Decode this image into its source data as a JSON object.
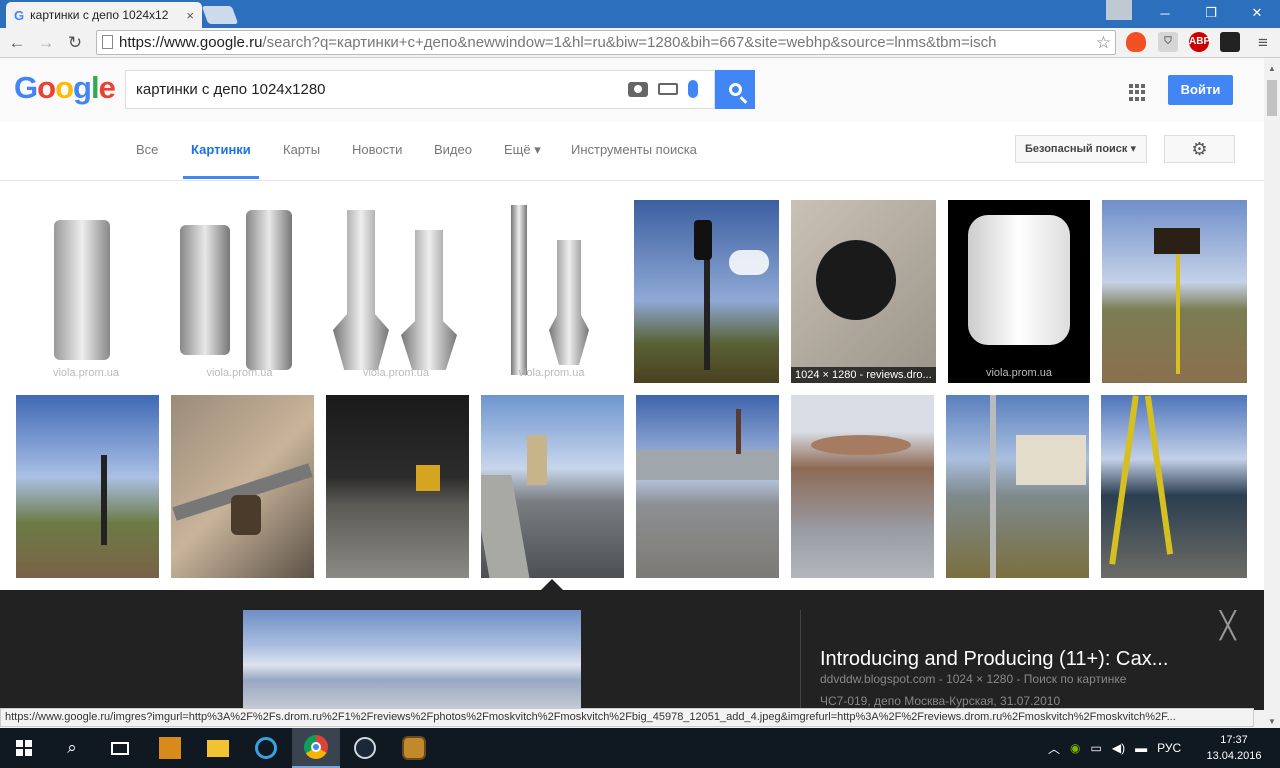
{
  "browser": {
    "tab_title": "картинки с депо 1024x12",
    "tab_close": "×",
    "url_host": "https://www.google.ru",
    "url_rest": "/search?q=картинки+с+депо&newwindow=1&hl=ru&biw=1280&bih=667&site=webhp&source=lnms&tbm=isch",
    "window_minimize": "─",
    "window_restore": "❐",
    "window_close": "✕",
    "ext_abp": "ABP"
  },
  "google": {
    "logo_letters": [
      "G",
      "o",
      "o",
      "g",
      "l",
      "e"
    ],
    "query": "картинки с депо 1024x1280",
    "signin_label": "Войти"
  },
  "search_tabs": [
    {
      "label": "Все"
    },
    {
      "label": "Картинки"
    },
    {
      "label": "Карты"
    },
    {
      "label": "Новости"
    },
    {
      "label": "Видео"
    },
    {
      "label": "Ещё ▾"
    },
    {
      "label": "Инструменты поиска"
    }
  ],
  "safe_search_label": "Безопасный поиск ▾",
  "results": {
    "watermark": "viola.prom.ua",
    "caption_dims": "1024 × 1280 - reviews.dro...",
    "colors": {
      "sky": "#6a8fc9",
      "grass": "#6f7a3c",
      "dark": "#111111",
      "gray": "#8a8a8a"
    }
  },
  "viewer": {
    "title": "Introducing and Producing (11+): Сах...",
    "meta": "ddvddw.blogspot.com  -  1024 × 1280  -  Поиск по картинке",
    "description": "ЧС7-019, депо Москва-Курская, 31.07.2010",
    "close_glyph": "╳"
  },
  "status_url": "https://www.google.ru/imgres?imgurl=http%3A%2F%2Fs.drom.ru%2F1%2Freviews%2Fphotos%2Fmoskvitch%2Fmoskvitch%2Fbig_45978_12051_add_4.jpeg&imgrefurl=http%3A%2F%2Freviews.drom.ru%2Fmoskvitch%2Fmoskvitch%2F...",
  "taskbar": {
    "lang": "РУС",
    "time": "17:37",
    "date": "13.04.2016"
  }
}
